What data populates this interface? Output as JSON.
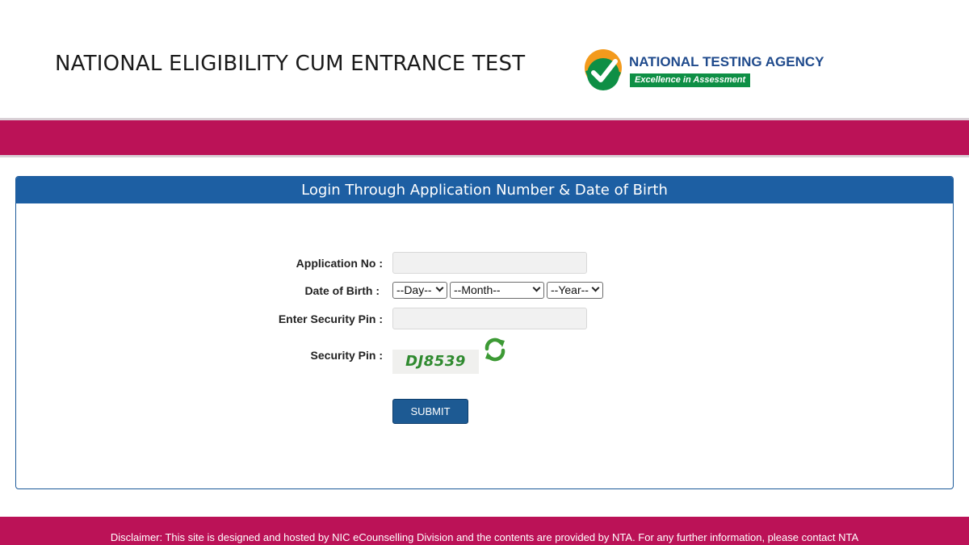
{
  "header": {
    "title": "NATIONAL ELIGIBILITY CUM ENTRANCE TEST",
    "logo": {
      "icon": "nta-checkmark-logo-icon",
      "name": "NATIONAL TESTING AGENCY",
      "tagline": "Excellence in Assessment"
    }
  },
  "login": {
    "heading": "Login Through Application Number & Date of Birth",
    "application_no": {
      "label": "Application No :",
      "value": "",
      "placeholder": ""
    },
    "dob": {
      "label": "Date of Birth :",
      "day": "--Day--",
      "month": "--Month--",
      "year": "--Year--"
    },
    "security_pin_input": {
      "label": "Enter Security Pin :",
      "value": "",
      "placeholder": ""
    },
    "security_pin": {
      "label": "Security Pin :",
      "code": "DJ8539",
      "refresh_icon": "refresh-icon"
    },
    "submit_label": "SUBMIT"
  },
  "footer": {
    "disclaimer": "Disclaimer: This site is designed and hosted by NIC eCounselling Division and the contents are provided by NTA. For any further information, please contact NTA"
  },
  "colors": {
    "band": "#bb1257",
    "panel_header": "#1d5fa3",
    "submit": "#1d5a93",
    "logo_green": "#0e8f45",
    "logo_orange": "#f39a1c",
    "logo_blue": "#1f4a8c"
  }
}
